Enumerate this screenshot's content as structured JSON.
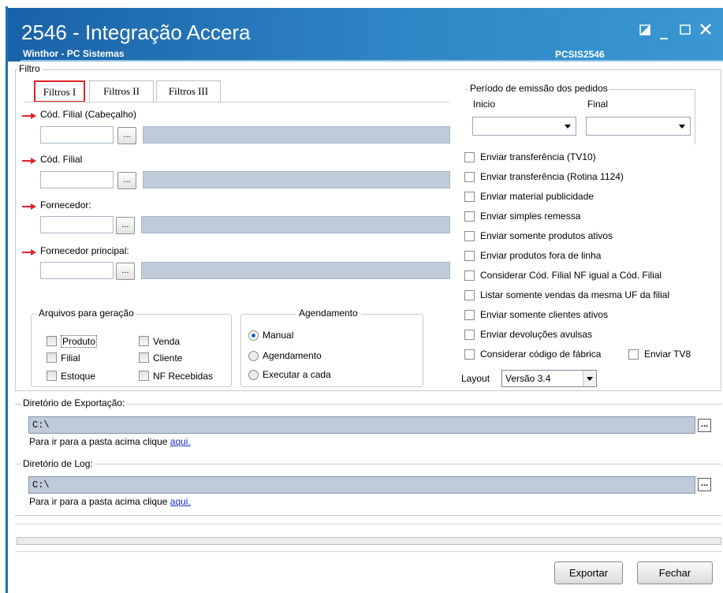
{
  "window": {
    "title": "2546 - Integração Accera",
    "subtitle": "Winthor - PC Sistemas",
    "code": "PCSIS2546"
  },
  "filtro": {
    "legend": "Filtro",
    "tabs": [
      "Filtros I",
      "Filtros II",
      "Filtros III"
    ],
    "fields": [
      {
        "label": "Cód. Filial (Cabeçalho)",
        "value": ""
      },
      {
        "label": "Cód. Filial",
        "value": ""
      },
      {
        "label": "Fornecedor:",
        "value": ""
      },
      {
        "label": "Fornecedor principal:",
        "value": ""
      }
    ],
    "lookup_button_label": "..."
  },
  "periodo": {
    "legend": "Período de emissão dos pedidos",
    "inicio_label": "Inicio",
    "final_label": "Final",
    "inicio_value": "",
    "final_value": ""
  },
  "options": [
    {
      "label": "Enviar transferência (TV10)",
      "checked": false
    },
    {
      "label": "Enviar transferência (Rotina 1124)",
      "checked": false
    },
    {
      "label": "Enviar material publicidade",
      "checked": false
    },
    {
      "label": "Enviar simples remessa",
      "checked": false
    },
    {
      "label": "Enviar somente produtos ativos",
      "checked": false
    },
    {
      "label": "Enviar produtos fora de linha",
      "checked": false
    },
    {
      "label": "Considerar Cód. Filial NF igual a Cód. Filial",
      "checked": false
    },
    {
      "label": "Listar somente vendas da mesma UF da filial",
      "checked": false
    },
    {
      "label": "Enviar somente clientes ativos",
      "checked": false
    },
    {
      "label": "Enviar devoluções avulsas",
      "checked": false
    },
    {
      "label": "Considerar código de fábrica",
      "checked": false
    }
  ],
  "enviar_tv8": {
    "label": "Enviar TV8",
    "checked": false
  },
  "layout": {
    "label": "Layout",
    "value": "Versão 3.4"
  },
  "arquivos": {
    "legend": "Arquivos para geração",
    "items": [
      {
        "label": "Produto",
        "checked": false
      },
      {
        "label": "Venda",
        "checked": false
      },
      {
        "label": "Filial",
        "checked": false
      },
      {
        "label": "Cliente",
        "checked": false
      },
      {
        "label": "Estoque",
        "checked": false
      },
      {
        "label": "NF Recebidas",
        "checked": false
      }
    ]
  },
  "agendamento": {
    "legend": "Agendamento",
    "options": [
      {
        "label": "Manual",
        "selected": true
      },
      {
        "label": "Agendamento",
        "selected": false
      },
      {
        "label": "Executar a cada",
        "selected": false
      }
    ]
  },
  "exportacao": {
    "legend": "Diretório de Exportação:",
    "path": "C:\\",
    "hint": "Para ir para a pasta acima clique ",
    "link": "aqui."
  },
  "log": {
    "legend": "Diretório de Log:",
    "path": "C:\\",
    "hint": "Para ir para a pasta acima clique ",
    "link": "aqui."
  },
  "buttons": {
    "exportar": "Exportar",
    "fechar": "Fechar",
    "browse": "..."
  },
  "colors": {
    "titlebar": "#1a62a8",
    "highlight": "#e0202a",
    "field_gray": "#bfcbd8",
    "link": "#1a2fd1"
  }
}
